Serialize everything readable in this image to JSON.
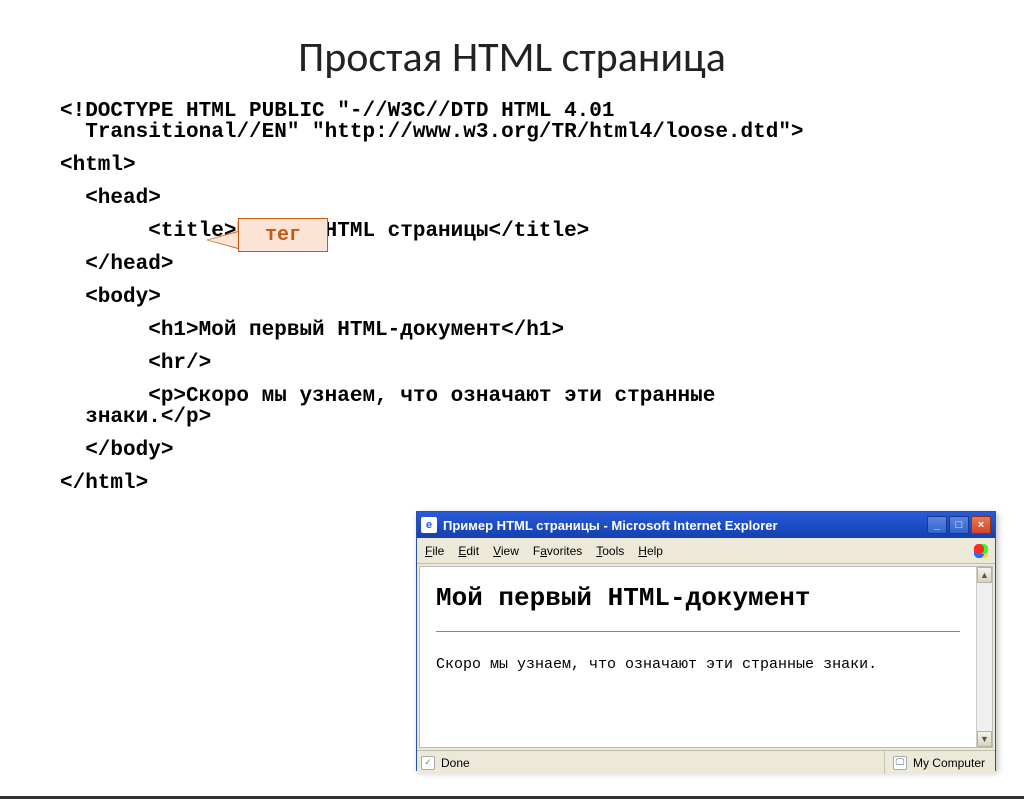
{
  "title": "Простая HTML страница",
  "callout_label": "тег",
  "code": {
    "doctype1": "<!DOCTYPE HTML PUBLIC \"-//W3C//DTD HTML 4.01",
    "doctype2": "  Transitional//EN\" \"http://www.w3.org/TR/html4/loose.dtd\">",
    "html_open": "<html>",
    "head_open": "  <head>",
    "title_line": "       <title>Пример HTML страницы</title>",
    "head_close": "  </head>",
    "body_open": "  <body>",
    "h1_line": "       <h1>Мой первый HTML-документ</h1>",
    "hr_line": "       <hr/>",
    "p_line1": "       <p>Скоро мы узнаем, что означают эти странные",
    "p_line2": "  знаки.</p>",
    "body_close": "  </body>",
    "html_close": "</html>"
  },
  "ie": {
    "title": "Пример HTML страницы - Microsoft Internet Explorer",
    "icon_glyph": "e",
    "btn_min": "_",
    "btn_max": "□",
    "btn_close": "×",
    "menu": {
      "file": "File",
      "edit": "Edit",
      "view": "View",
      "favorites": "Favorites",
      "tools": "Tools",
      "help": "Help"
    },
    "content": {
      "h1": "Мой первый HTML-документ",
      "p": "Скоро мы узнаем, что означают эти странные знаки."
    },
    "scroll_up": "▲",
    "scroll_down": "▼",
    "status_left_icon": "✓",
    "status_left_text": "Done",
    "status_right_icon": "🖵",
    "status_right_text": "My Computer"
  }
}
